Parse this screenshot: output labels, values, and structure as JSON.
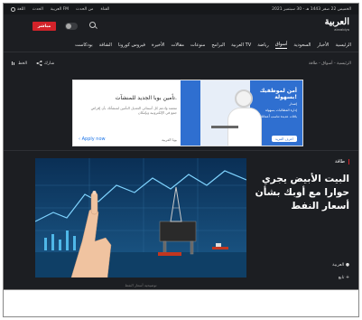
{
  "topbar": {
    "date": "الخميس 22 صفر 1443 هـ - 30 سبتمبر 2021",
    "links": [
      "القناة",
      "من الحدث",
      "العربية FM",
      "الحدث"
    ],
    "language": "اللغة"
  },
  "header": {
    "live_label": "مباشر",
    "logo_ar": "العربية",
    "logo_en": "alarabiya"
  },
  "nav": {
    "items": [
      "الرئيسية",
      "الأخبار",
      "السعودية",
      "أسواق",
      "رياضة",
      "العربية TV",
      "البرامج",
      "منوعات",
      "مقالات",
      "الأخيرة",
      "فيروس كورونا",
      "الشافة",
      "بودكاست"
    ],
    "active_index": 3
  },
  "sharebar": {
    "breadcrumb": "الرئيسية - أسواق - طاقة",
    "share": "شارك",
    "fontsize": "الخط"
  },
  "ad": {
    "right_title": "أمن لموظفيك بسهولة!",
    "right_lines": [
      "إصدار",
      "إدارة المطالبات بسهولة",
      "باقات عديدة تناسب أعمالك"
    ],
    "right_cta": "اعرف المزيد",
    "left_title": "تأمين بوبا الجديد للمنشآت.",
    "left_desc": "متعمد وادعم كل أسمائي التعديل التأمين لمنشآتك بأن إقراض جمع في الإلكترونية وبإمكان",
    "apply": "Apply now",
    "brand": "بوبا العربية"
  },
  "article": {
    "tag": "طاقة",
    "headline": "البيت الأبيض يجري حوارا مع أوبك بشأن أسعار النفط",
    "source": "العربية",
    "follow": "تابع",
    "caption": "توضيحية أسعار النفط"
  },
  "colors": {
    "background": "#1c1e22",
    "accent": "#d3232a",
    "ad_blue": "#2f6fd0"
  }
}
